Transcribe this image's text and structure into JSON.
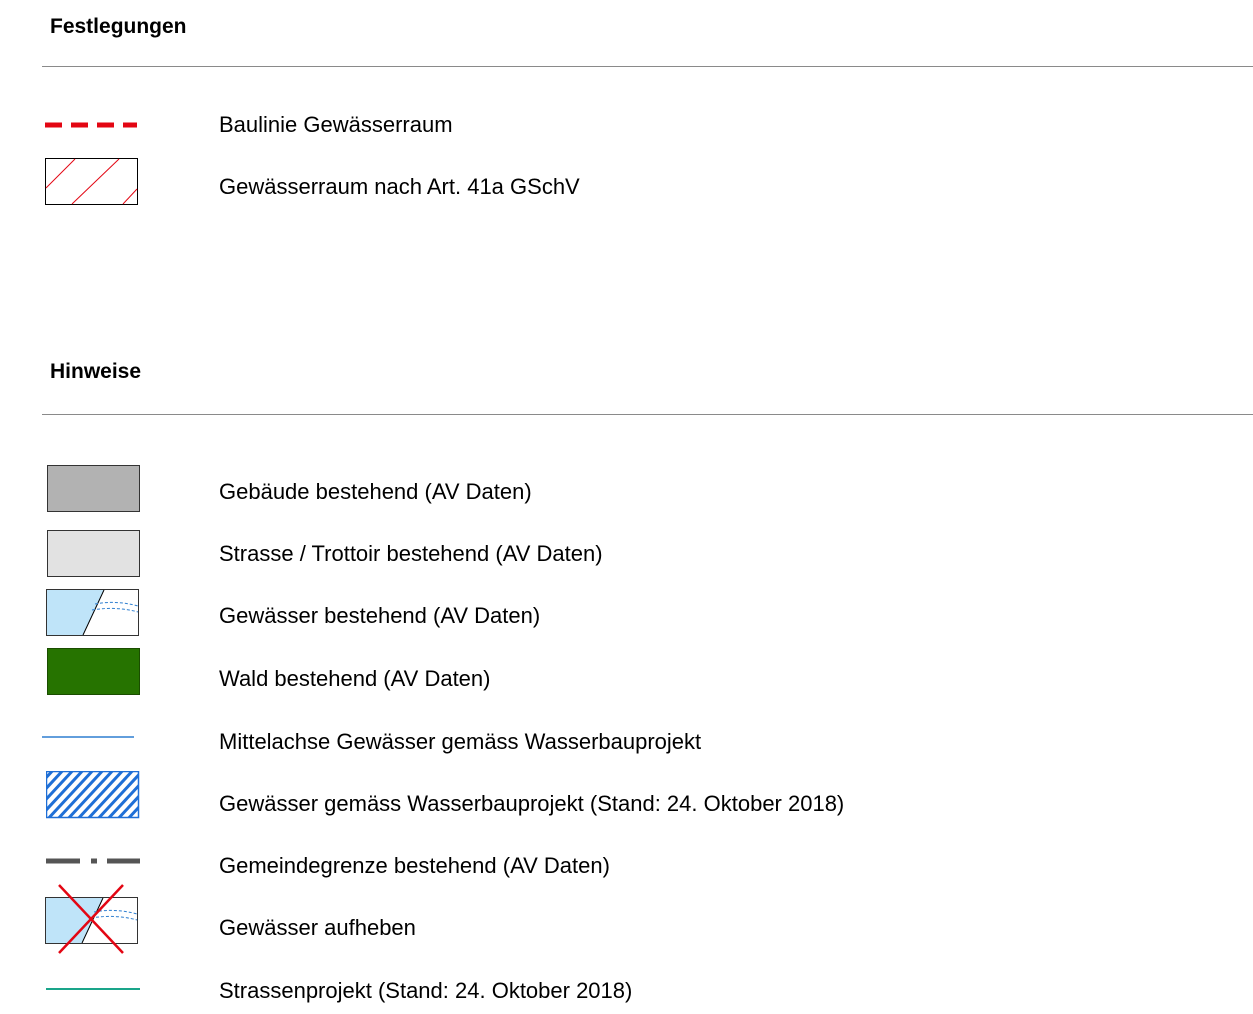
{
  "sections": {
    "festlegungen": {
      "title": "Festlegungen",
      "items": [
        {
          "label": "Baulinie Gewässerraum",
          "symbol": "dashed-red-line-icon"
        },
        {
          "label": "Gewässerraum nach Art. 41a GSchV",
          "symbol": "red-hatch-box-icon"
        }
      ]
    },
    "hinweise": {
      "title": "Hinweise",
      "items": [
        {
          "label": "Gebäude bestehend (AV Daten)",
          "symbol": "grey-box-icon"
        },
        {
          "label": "Strasse / Trottoir bestehend (AV Daten)",
          "symbol": "light-grey-box-icon"
        },
        {
          "label": "Gewässer bestehend (AV Daten)",
          "symbol": "water-box-icon"
        },
        {
          "label": "Wald bestehend (AV Daten)",
          "symbol": "green-box-icon"
        },
        {
          "label": "Mittelachse Gewässer gemäss Wasserbauprojekt",
          "symbol": "blue-line-icon"
        },
        {
          "label": "Gewässer gemäss Wasserbauprojekt (Stand: 24. Oktober 2018)",
          "symbol": "blue-hatch-box-icon"
        },
        {
          "label": "Gemeindegrenze bestehend (AV Daten)",
          "symbol": "dash-dot-line-icon"
        },
        {
          "label": "Gewässer aufheben",
          "symbol": "water-crossed-box-icon"
        },
        {
          "label": "Strassenprojekt (Stand: 24. Oktober 2018)",
          "symbol": "teal-line-icon"
        }
      ]
    }
  },
  "colors": {
    "baulinie": "#e30613",
    "gebaeude": "#b2b2b2",
    "strasse": "#e2e2e2",
    "gewaesser": "#bfe4f9",
    "wald": "#267300",
    "mittelachse": "#2f7fd0",
    "hatch_blue": "#1f6fd6",
    "gemeindegrenze": "#555555",
    "strassenprojekt": "#1aa58a"
  }
}
